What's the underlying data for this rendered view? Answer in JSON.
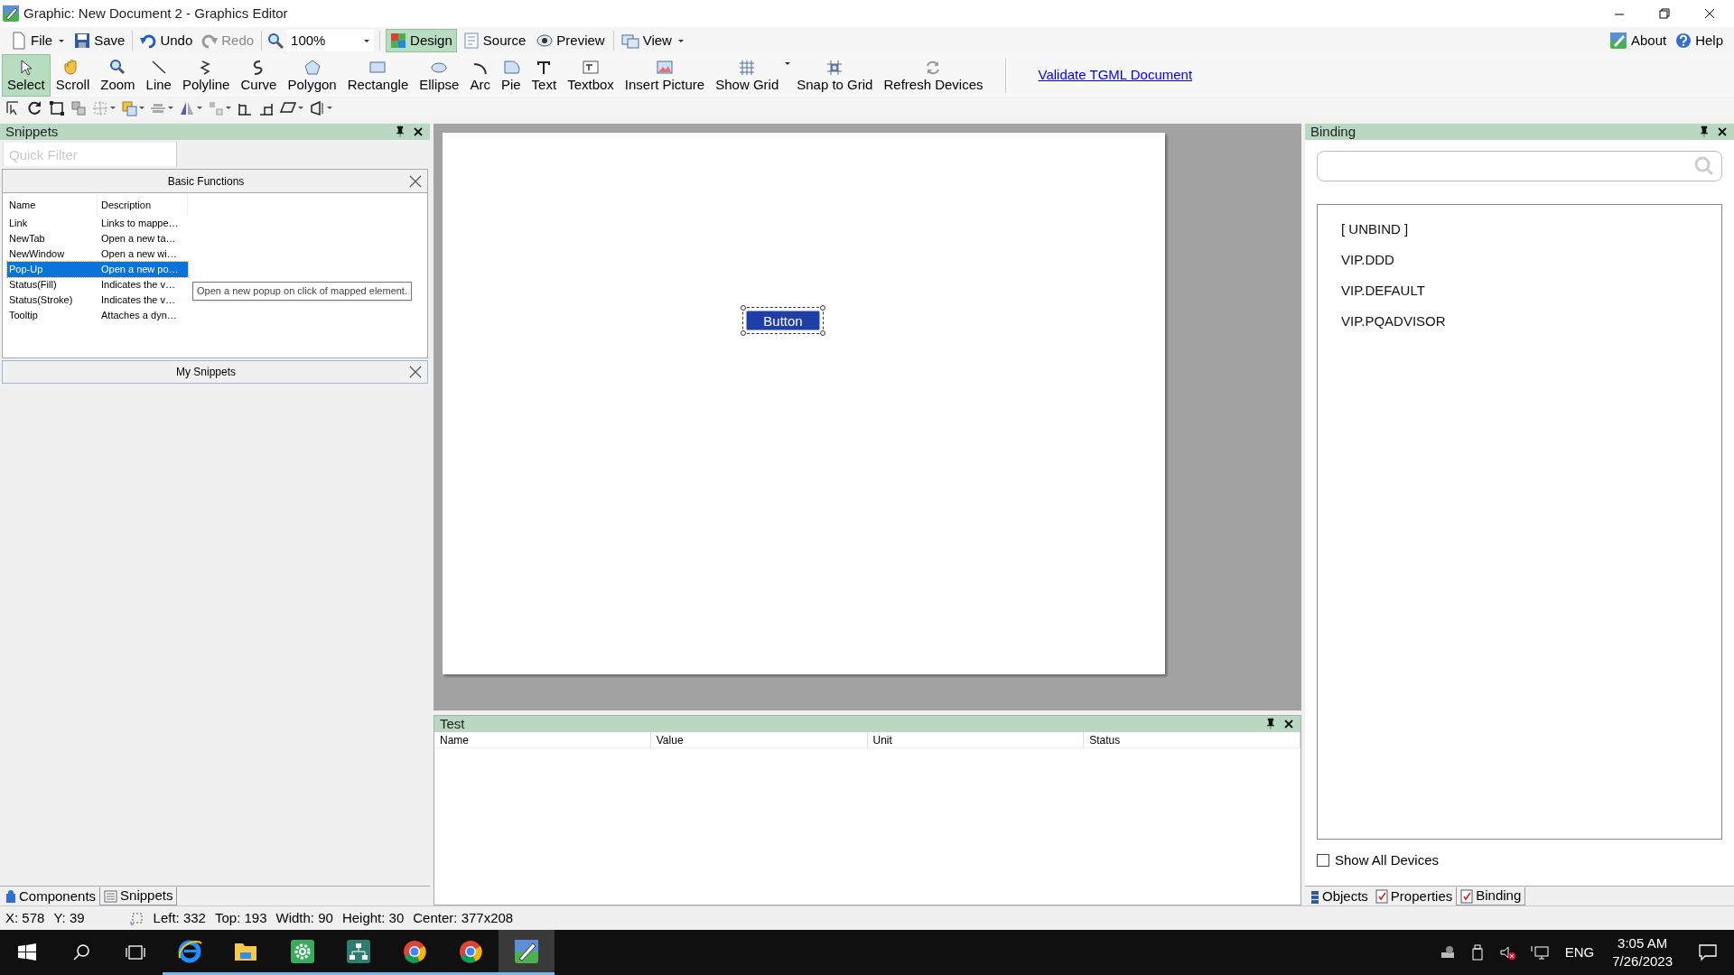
{
  "window": {
    "title": "Graphic: New Document 2 - Graphics Editor"
  },
  "menu_bar": {
    "file": "File",
    "save": "Save",
    "undo": {
      "label": "Undo",
      "disabled": false
    },
    "redo": {
      "label": "Redo",
      "disabled": true
    },
    "zoom": "100%",
    "modes": [
      {
        "label": "Design",
        "selected": true
      },
      {
        "label": "Source",
        "selected": false
      },
      {
        "label": "Preview",
        "selected": false
      }
    ],
    "view": "View",
    "about": "About",
    "help": "Help"
  },
  "draw_tools": [
    {
      "label": "Select",
      "selected": true
    },
    {
      "label": "Scroll",
      "selected": false
    },
    {
      "label": "Zoom",
      "selected": false
    },
    {
      "label": "Line",
      "selected": false
    },
    {
      "label": "Polyline",
      "selected": false
    },
    {
      "label": "Curve",
      "selected": false
    },
    {
      "label": "Polygon",
      "selected": false
    },
    {
      "label": "Rectangle",
      "selected": false
    },
    {
      "label": "Ellipse",
      "selected": false
    },
    {
      "label": "Arc",
      "selected": false
    },
    {
      "label": "Pie",
      "selected": false
    },
    {
      "label": "Text",
      "selected": false
    },
    {
      "label": "Textbox",
      "selected": false
    },
    {
      "label": "Insert Picture",
      "selected": false
    },
    {
      "label": "Show Grid",
      "selected": false
    },
    {
      "label": "Snap to Grid",
      "selected": false
    },
    {
      "label": "Refresh Devices",
      "selected": false
    }
  ],
  "validate_link": "Validate TGML Document",
  "snippets": {
    "title": "Snippets",
    "filter_placeholder": "Quick Filter",
    "basic": {
      "title": "Basic Functions",
      "columns": [
        "Name",
        "Description"
      ],
      "rows": [
        {
          "name": "Link",
          "description": "Links to mappe…",
          "selected": false
        },
        {
          "name": "NewTab",
          "description": "Open a new ta…",
          "selected": false
        },
        {
          "name": "NewWindow",
          "description": "Open a new wi…",
          "selected": false
        },
        {
          "name": "Pop-Up",
          "description": "Open a new po…",
          "selected": true
        },
        {
          "name": "Status(Fill)",
          "description": "Indicates the v…",
          "selected": false
        },
        {
          "name": "Status(Stroke)",
          "description": "Indicates the v…",
          "selected": false
        },
        {
          "name": "Tooltip",
          "description": "Attaches a dyn…",
          "selected": false
        }
      ],
      "tooltip": "Open a new popup on click of mapped element."
    },
    "my_snippets": {
      "title": "My Snippets"
    },
    "tabs": [
      {
        "label": "Components",
        "selected": false
      },
      {
        "label": "Snippets",
        "selected": true
      }
    ]
  },
  "canvas": {
    "button_label": "Button"
  },
  "test": {
    "title": "Test",
    "columns": [
      "Name",
      "Value",
      "Unit",
      "Status"
    ]
  },
  "binding": {
    "title": "Binding",
    "items": [
      "[ UNBIND ]",
      "VIP.DDD",
      "VIP.DEFAULT",
      "VIP.PQADVISOR"
    ],
    "show_all_devices": {
      "label": "Show All Devices",
      "checked": false
    },
    "tabs": [
      {
        "label": "Objects",
        "selected": false
      },
      {
        "label": "Properties",
        "selected": false
      },
      {
        "label": "Binding",
        "selected": true
      }
    ]
  },
  "status_bar": {
    "x": "X: 578",
    "y": "Y: 39",
    "left": "Left: 332",
    "top": "Top: 193",
    "width": "Width: 90",
    "height": "Height: 30",
    "center": "Center: 377x208"
  },
  "taskbar": {
    "language": "ENG",
    "time": "3:05 AM",
    "date": "7/26/2023"
  }
}
